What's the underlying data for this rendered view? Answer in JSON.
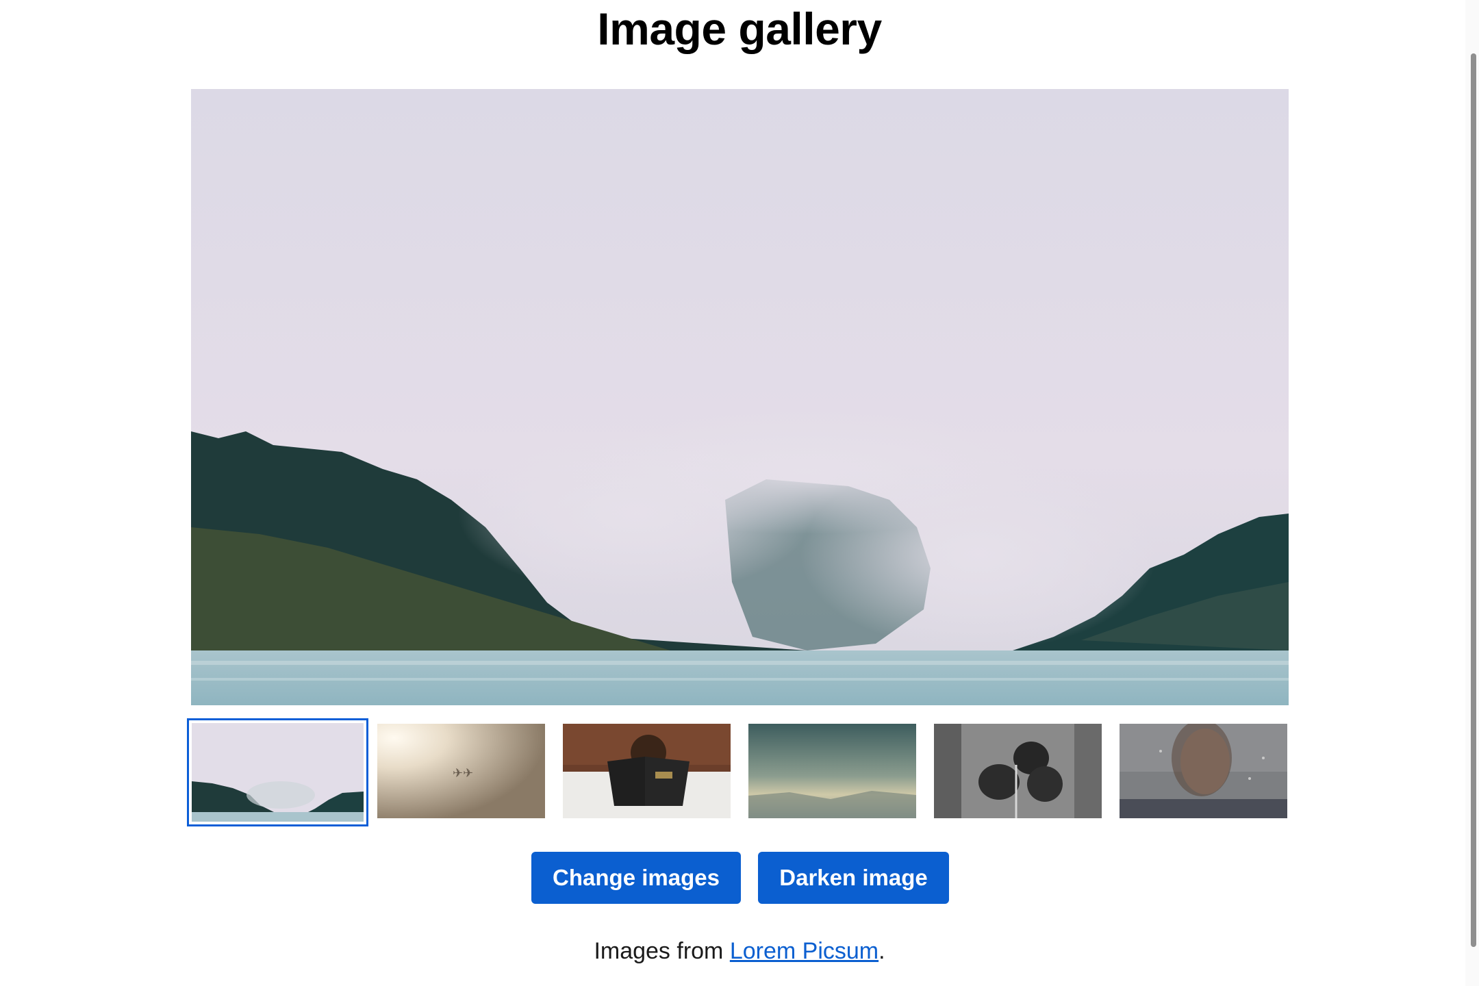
{
  "page": {
    "title": "Image gallery"
  },
  "gallery": {
    "main_image": {
      "icon": "misty-forest-lake-photo"
    },
    "thumbnails": [
      {
        "icon": "misty-forest-lake-photo",
        "selected": true
      },
      {
        "icon": "jets-in-sky-photo",
        "selected": false
      },
      {
        "icon": "child-reading-bible-photo",
        "selected": false
      },
      {
        "icon": "cloudy-sky-photo",
        "selected": false
      },
      {
        "icon": "pine-cones-photo",
        "selected": false
      },
      {
        "icon": "woman-behind-rainy-glass-photo",
        "selected": false
      }
    ]
  },
  "buttons": {
    "change_label": "Change images",
    "darken_label": "Darken image"
  },
  "credit": {
    "prefix": "Images from ",
    "link_label": "Lorem Picsum",
    "suffix": "."
  },
  "colors": {
    "accent": "#0b5fd0",
    "selected_border": "#0b5ed7"
  }
}
